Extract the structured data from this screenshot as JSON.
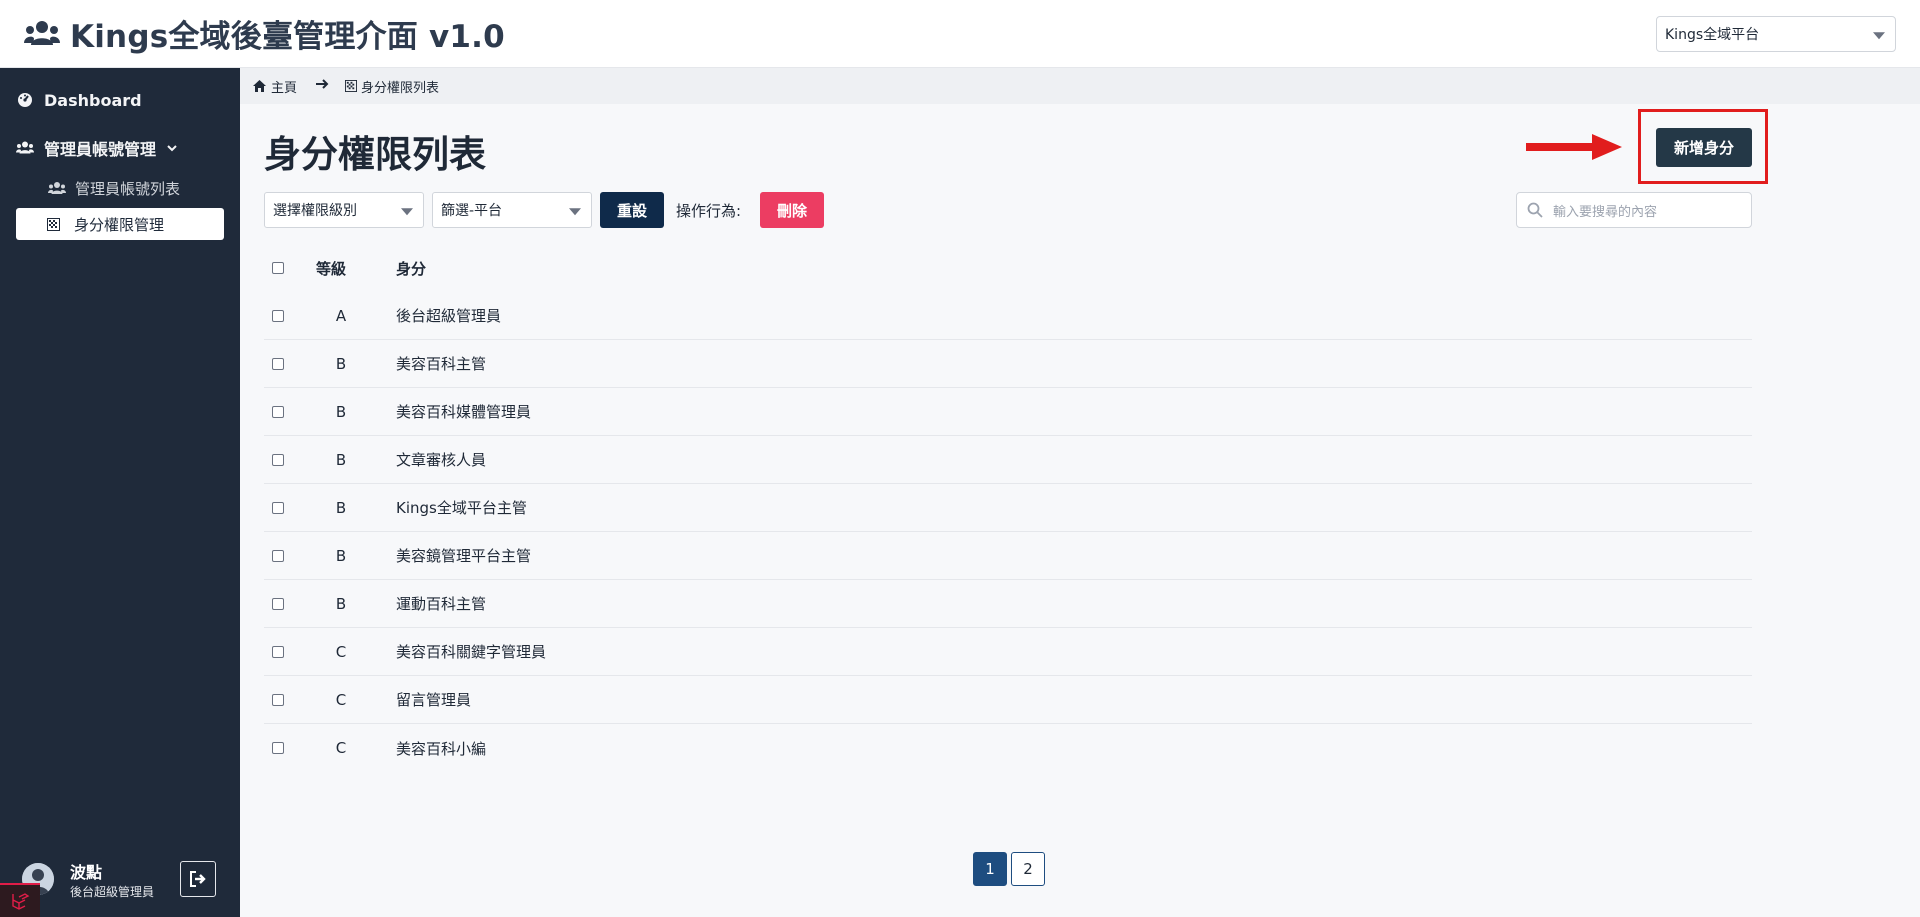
{
  "header": {
    "title": "Kings全域後臺管理介面 v1.0",
    "platform_select": "Kings全域平台"
  },
  "sidebar": {
    "dashboard": "Dashboard",
    "group_label": "管理員帳號管理",
    "items": [
      {
        "label": "管理員帳號列表"
      },
      {
        "label": "身分權限管理"
      }
    ],
    "user": {
      "name": "波點",
      "role": "後台超級管理員"
    }
  },
  "breadcrumb": {
    "home": "主頁",
    "current": "身分權限列表"
  },
  "main": {
    "title": "身分權限列表",
    "add_button": "新增身分",
    "filters": {
      "level_select": "選擇權限級別",
      "platform_select": "篩選-平台",
      "reset_button": "重設",
      "operation_label": "操作行為:",
      "delete_button": "刪除",
      "search_placeholder": "輸入要搜尋的內容"
    },
    "table": {
      "headers": {
        "level": "等級",
        "role": "身分"
      },
      "rows": [
        {
          "level": "A",
          "role": "後台超級管理員"
        },
        {
          "level": "B",
          "role": "美容百科主管"
        },
        {
          "level": "B",
          "role": "美容百科媒體管理員"
        },
        {
          "level": "B",
          "role": "文章審核人員"
        },
        {
          "level": "B",
          "role": "Kings全域平台主管"
        },
        {
          "level": "B",
          "role": "美容鏡管理平台主管"
        },
        {
          "level": "B",
          "role": "運動百科主管"
        },
        {
          "level": "C",
          "role": "美容百科關鍵字管理員"
        },
        {
          "level": "C",
          "role": "留言管理員"
        },
        {
          "level": "C",
          "role": "美容百科小編"
        }
      ]
    },
    "pagination": {
      "pages": [
        "1",
        "2"
      ],
      "current": "1"
    }
  }
}
